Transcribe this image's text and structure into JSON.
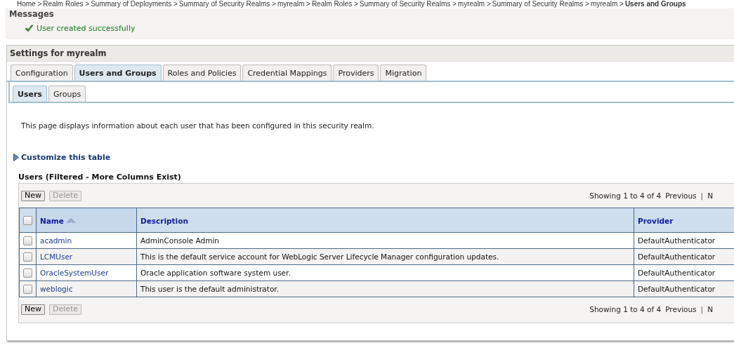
{
  "breadcrumb": {
    "items": [
      "Home >",
      "Realm Roles >",
      "Summary of Deployments >",
      "Summary of Security Realms >",
      "myrealm >",
      "Realm Roles >",
      "Summary of Security Realms >",
      "myrealm >",
      "Summary of Security Realms >",
      "myrealm >"
    ],
    "current": "Users and Groups"
  },
  "messages": {
    "title": "Messages",
    "items": [
      {
        "kind": "success",
        "text": "User created successfully"
      }
    ]
  },
  "settings": {
    "title": "Settings for myrealm",
    "tabs": [
      {
        "label": "Configuration",
        "selected": false
      },
      {
        "label": "Users and Groups",
        "selected": true
      },
      {
        "label": "Roles and Policies",
        "selected": false
      },
      {
        "label": "Credential Mappings",
        "selected": false
      },
      {
        "label": "Providers",
        "selected": false
      },
      {
        "label": "Migration",
        "selected": false
      }
    ],
    "subtabs": [
      {
        "label": "Users",
        "selected": true
      },
      {
        "label": "Groups",
        "selected": false
      }
    ],
    "intro": "This page displays information about each user that has been configured in this security realm.",
    "customize_link": "Customize this table",
    "table": {
      "title": "Users (Filtered - More Columns Exist)",
      "select_all_checked": false,
      "buttons": [
        {
          "label": "New",
          "disabled": false
        },
        {
          "label": "Delete",
          "disabled": true
        }
      ],
      "paging": {
        "showing": "Showing 1 to 4 of 4",
        "previous": "Previous",
        "separator": "|",
        "next": "N"
      },
      "columns": [
        {
          "label": "Name",
          "sorted": true
        },
        {
          "label": "Description",
          "sorted": false
        },
        {
          "label": "Provider",
          "sorted": false
        }
      ],
      "rows": [
        {
          "checked": false,
          "name": "acadmin",
          "description": "AdminConsole Admin",
          "provider": "DefaultAuthenticator"
        },
        {
          "checked": false,
          "name": "LCMUser",
          "description": "This is the default service account for WebLogic Server Lifecycle Manager configuration updates.",
          "provider": "DefaultAuthenticator"
        },
        {
          "checked": false,
          "name": "OracleSystemUser",
          "description": "Oracle application software system user.",
          "provider": "DefaultAuthenticator"
        },
        {
          "checked": false,
          "name": "weblogic",
          "description": "This user is the default administrator.",
          "provider": "DefaultAuthenticator"
        }
      ],
      "bottom_buttons": [
        {
          "label": "New",
          "disabled": false
        },
        {
          "label": "Delete",
          "disabled": true
        }
      ],
      "bottom_paging": {
        "showing": "Showing 1 to 4 of 4",
        "previous": "Previous",
        "separator": "|",
        "next": "N"
      }
    }
  }
}
